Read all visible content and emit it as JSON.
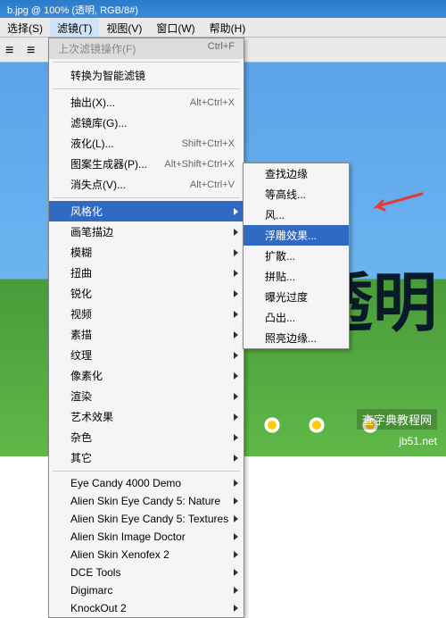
{
  "titlebar": "b.jpg @ 100% (透明, RGB/8#)",
  "menubar": [
    "选择(S)",
    "滤镜(T)",
    "视图(V)",
    "窗口(W)",
    "帮助(H)"
  ],
  "menubar_active_index": 1,
  "menu_header": {
    "label": "上次滤镜操作(F)",
    "shortcut": "Ctrl+F"
  },
  "menu_top": {
    "label": "转换为智能滤镜"
  },
  "menu_group1": [
    {
      "label": "抽出(X)...",
      "shortcut": "Alt+Ctrl+X"
    },
    {
      "label": "滤镜库(G)...",
      "shortcut": ""
    },
    {
      "label": "液化(L)...",
      "shortcut": "Shift+Ctrl+X"
    },
    {
      "label": "图案生成器(P)...",
      "shortcut": "Alt+Shift+Ctrl+X"
    },
    {
      "label": "消失点(V)...",
      "shortcut": "Alt+Ctrl+V"
    }
  ],
  "menu_group2": [
    {
      "label": "风格化",
      "sub": true,
      "selected": true
    },
    {
      "label": "画笔描边",
      "sub": true
    },
    {
      "label": "模糊",
      "sub": true
    },
    {
      "label": "扭曲",
      "sub": true
    },
    {
      "label": "锐化",
      "sub": true
    },
    {
      "label": "视频",
      "sub": true
    },
    {
      "label": "素描",
      "sub": true
    },
    {
      "label": "纹理",
      "sub": true
    },
    {
      "label": "像素化",
      "sub": true
    },
    {
      "label": "渲染",
      "sub": true
    },
    {
      "label": "艺术效果",
      "sub": true
    },
    {
      "label": "杂色",
      "sub": true
    },
    {
      "label": "其它",
      "sub": true
    }
  ],
  "menu_group3": [
    {
      "label": "Eye Candy 4000 Demo",
      "sub": true
    },
    {
      "label": "Alien Skin Eye Candy 5: Nature",
      "sub": true
    },
    {
      "label": "Alien Skin Eye Candy 5: Textures",
      "sub": true
    },
    {
      "label": "Alien Skin Image Doctor",
      "sub": true
    },
    {
      "label": "Alien Skin Xenofex 2",
      "sub": true
    },
    {
      "label": "DCE Tools",
      "sub": true
    },
    {
      "label": "Digimarc",
      "sub": true
    },
    {
      "label": "KnockOut 2",
      "sub": true
    }
  ],
  "submenu": [
    {
      "label": "查找边缘"
    },
    {
      "label": "等高线..."
    },
    {
      "label": "风..."
    },
    {
      "label": "浮雕效果...",
      "selected": true
    },
    {
      "label": "扩散..."
    },
    {
      "label": "拼贴..."
    },
    {
      "label": "曝光过度"
    },
    {
      "label": "凸出..."
    },
    {
      "label": "照亮边缘..."
    }
  ],
  "canvas_text": "透明",
  "watermark": "查字典教程网",
  "url": "jb51.net"
}
